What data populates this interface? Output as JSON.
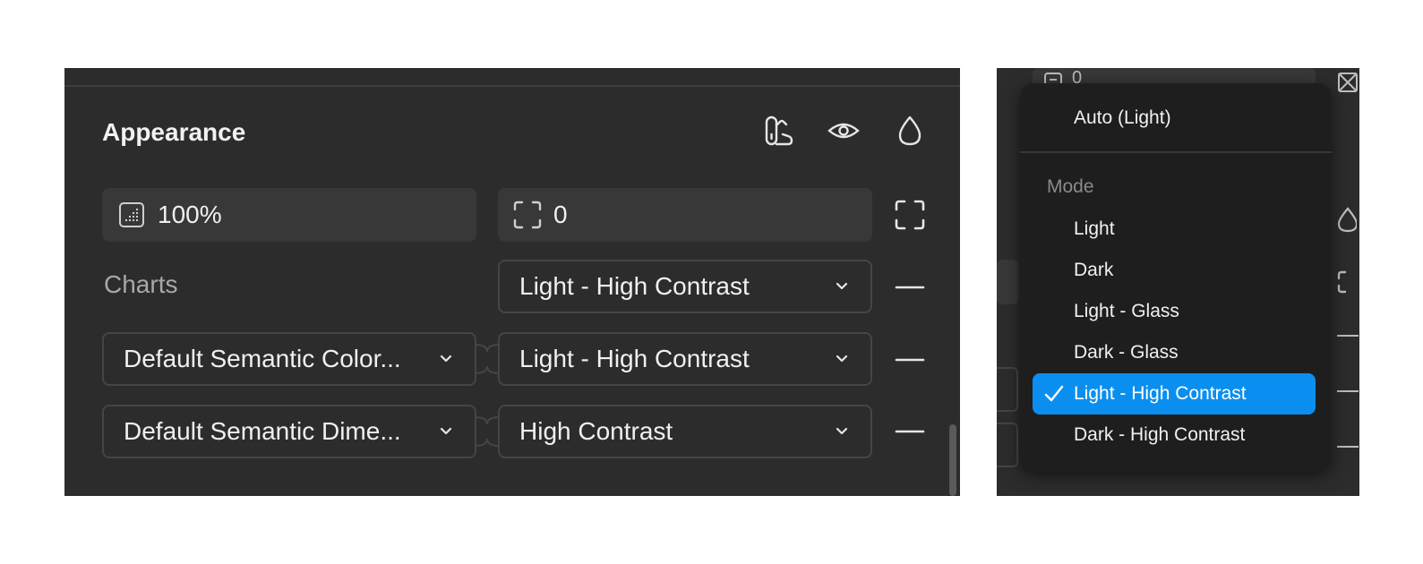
{
  "appearance": {
    "title": "Appearance",
    "opacity_value": "100%",
    "radius_value": "0",
    "charts_label": "Charts",
    "charts_mode": "Light - High Contrast",
    "colors_collection": "Default Semantic Color...",
    "colors_mode": "Light - High Contrast",
    "dimensions_collection": "Default Semantic Dime...",
    "dimensions_mode": "High Contrast",
    "icons": {
      "variable_modes": "variable-modes-icon",
      "visibility": "eye-icon",
      "fill": "drop-icon",
      "radius": "corner-radius-icon",
      "independent_corners": "independent-corners-icon",
      "opacity": "opacity-icon",
      "remove": "minus-icon"
    }
  },
  "mode_dropdown": {
    "auto_option": "Auto (Light)",
    "heading": "Mode",
    "options": [
      "Light",
      "Dark",
      "Light - Glass",
      "Dark - Glass",
      "Light - High Contrast",
      "Dark - High Contrast"
    ],
    "selected": "Light - High Contrast",
    "background_value": "0"
  },
  "colors": {
    "panel_bg": "#2c2c2c",
    "field_bg": "#383838",
    "dropdown_bg": "#1e1e1e",
    "accent": "#0a8ff0"
  }
}
